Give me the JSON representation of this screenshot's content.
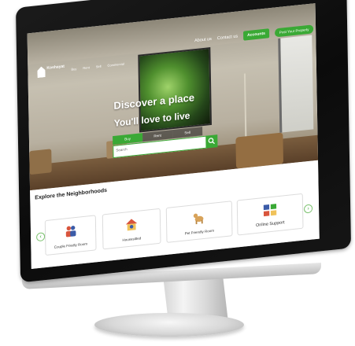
{
  "site": {
    "logo_text": "Koshayat",
    "nav": [
      "Buy",
      "Rent",
      "Sell",
      "Commercial"
    ],
    "top_links": {
      "about": "About us",
      "contact": "Contact us",
      "accounts": "Accounts",
      "post": "Post Your Property"
    }
  },
  "hero": {
    "headline_line1": "Discover a place",
    "headline_line2": "You'll love to live",
    "tabs": [
      "Buy",
      "Rent",
      "Sell"
    ],
    "active_tab": "Buy",
    "search_placeholder": "Search"
  },
  "neighborhoods": {
    "title": "Explore the Neighborhoods",
    "cards": [
      {
        "label": "Couple Friedly Room",
        "icon": "couple-icon"
      },
      {
        "label": "Housesitted",
        "icon": "house-sitting-icon"
      },
      {
        "label": "Pet Friendly Room",
        "icon": "dog-icon"
      },
      {
        "label": "Online Support",
        "icon": "online-support-icon"
      }
    ]
  },
  "colors": {
    "accent": "#3aa935",
    "bezel": "#111111",
    "border": "#dcdcdc"
  }
}
